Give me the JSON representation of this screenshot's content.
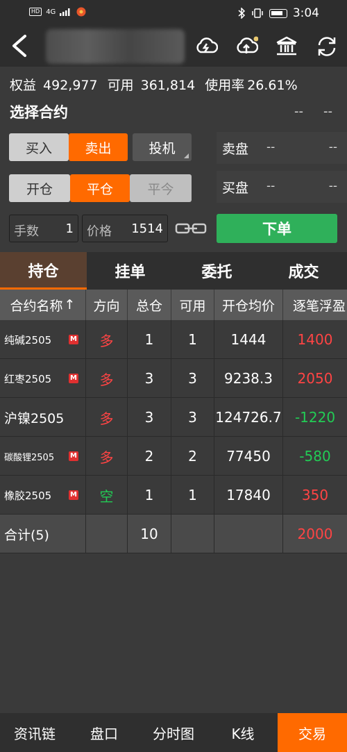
{
  "status_bar": {
    "hd": "HD",
    "network": "4G",
    "time": "3:04"
  },
  "summary": {
    "equity_label": "权益",
    "equity_value": "492,977",
    "available_label": "可用",
    "available_value": "361,814",
    "usage_label": "使用率",
    "usage_value": "26.61%"
  },
  "contract": {
    "title": "选择合约",
    "dash1": "--",
    "dash2": "--"
  },
  "order_panel": {
    "buy": "买入",
    "sell": "卖出",
    "speculation": "投机",
    "open": "开仓",
    "close": "平仓",
    "close_today": "平今",
    "qty_label": "手数",
    "qty_value": "1",
    "price_label": "价格",
    "price_value": "1514",
    "place_order": "下单"
  },
  "quotes": {
    "ask_label": "卖盘",
    "ask_v1": "--",
    "ask_v2": "--",
    "bid_label": "买盘",
    "bid_v1": "--",
    "bid_v2": "--"
  },
  "tabs": [
    "持仓",
    "挂单",
    "委托",
    "成交"
  ],
  "table": {
    "headers": [
      "合约名称",
      "方向",
      "总仓",
      "可用",
      "开仓均价",
      "逐笔浮盈"
    ],
    "sort_arrow": "↑",
    "rows": [
      {
        "name": "纯碱2505",
        "badge": "M",
        "dir": "多",
        "total": "1",
        "avail": "1",
        "price": "1444",
        "pnl": "1400"
      },
      {
        "name": "红枣2505",
        "badge": "M",
        "dir": "多",
        "total": "3",
        "avail": "3",
        "price": "9238.3",
        "pnl": "2050"
      },
      {
        "name": "沪镍2505",
        "badge": "",
        "dir": "多",
        "total": "3",
        "avail": "3",
        "price": "124726.7",
        "pnl": "-1220"
      },
      {
        "name": "碳酸锂2505",
        "badge": "M",
        "dir": "多",
        "total": "2",
        "avail": "2",
        "price": "77450",
        "pnl": "-580"
      },
      {
        "name": "橡胶2505",
        "badge": "M",
        "dir": "空",
        "total": "1",
        "avail": "1",
        "price": "17840",
        "pnl": "350"
      }
    ],
    "total": {
      "name": "合计(5)",
      "total": "10",
      "pnl": "2000"
    }
  },
  "bottom_nav": [
    "资讯链",
    "盘口",
    "分时图",
    "K线",
    "交易"
  ],
  "colors": {
    "accent": "#ff6a00",
    "green": "#2fb05a",
    "red": "#ff4444"
  }
}
